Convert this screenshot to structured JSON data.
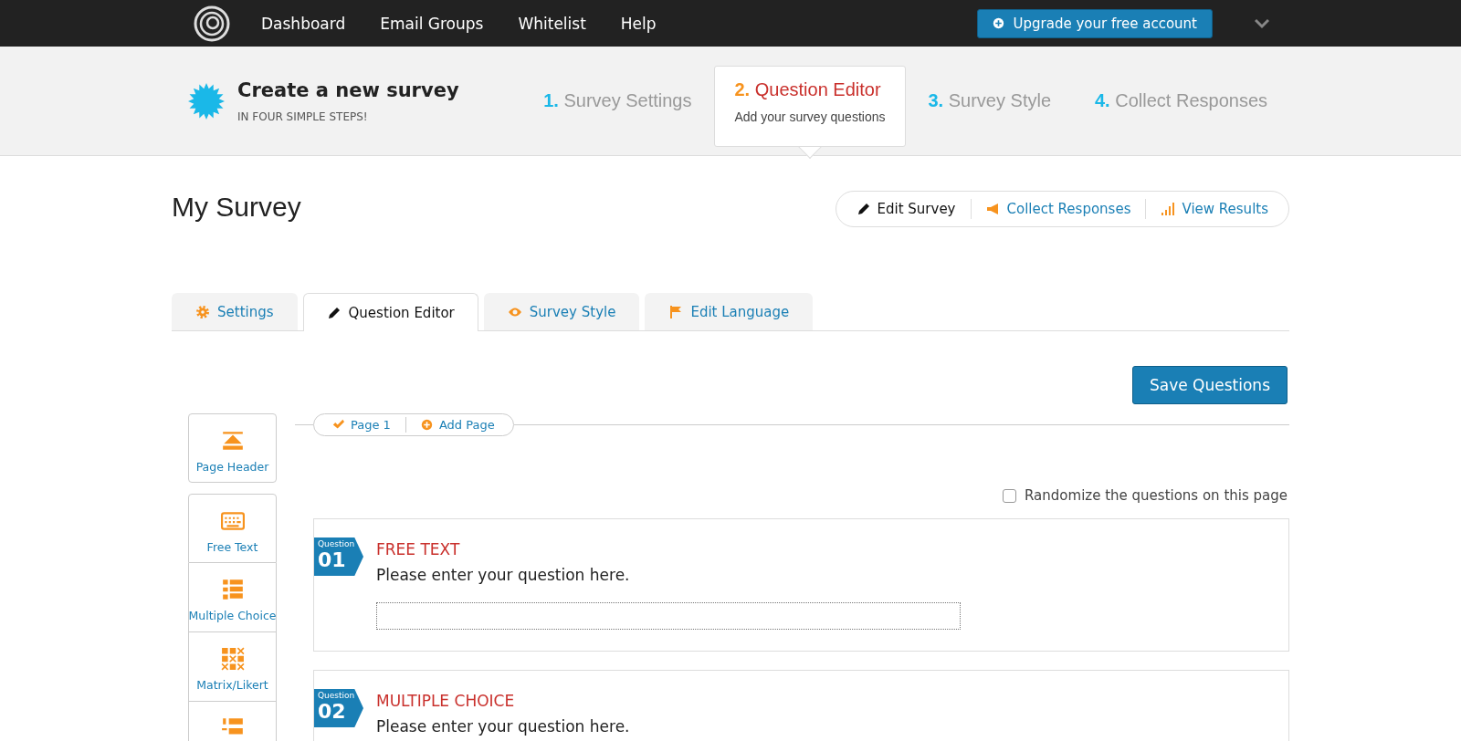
{
  "nav": {
    "links": [
      "Dashboard",
      "Email Groups",
      "Whitelist",
      "Help"
    ],
    "upgrade": "Upgrade your free account"
  },
  "wizard": {
    "title": "Create a new survey",
    "subtitle": "IN FOUR SIMPLE STEPS!",
    "steps": [
      {
        "number": "1.",
        "label": "Survey Settings",
        "selected": false
      },
      {
        "number": "2.",
        "label": "Question Editor",
        "hint": "Add your survey questions",
        "selected": true
      },
      {
        "number": "3.",
        "label": "Survey Style",
        "selected": false
      },
      {
        "number": "4.",
        "label": "Collect Responses",
        "selected": false
      }
    ]
  },
  "survey_title": "My Survey",
  "actions": [
    {
      "kind": "pencil",
      "label": "Edit Survey",
      "selected": true
    },
    {
      "kind": "megaphone",
      "label": "Collect Responses",
      "selected": false
    },
    {
      "kind": "bars",
      "label": "View Results",
      "selected": false
    }
  ],
  "tabs": [
    {
      "kind": "gear",
      "label": "Settings",
      "selected": false
    },
    {
      "kind": "pencil",
      "label": "Question Editor",
      "selected": true
    },
    {
      "kind": "eye",
      "label": "Survey Style",
      "selected": false
    },
    {
      "kind": "flag",
      "label": "Edit Language",
      "selected": false
    }
  ],
  "save_button": "Save Questions",
  "pages": [
    {
      "kind": "check",
      "label": "Page 1"
    },
    {
      "kind": "plus",
      "label": "Add Page"
    }
  ],
  "sidebar": [
    {
      "kind": "header",
      "label": "Page Header"
    },
    {
      "kind": "keyboard",
      "label": "Free Text"
    },
    {
      "kind": "list",
      "label": "Multiple Choice"
    },
    {
      "kind": "matrix",
      "label": "Matrix/Likert"
    },
    {
      "kind": "ranking"
    }
  ],
  "randomize": {
    "label": "Randomize the questions on this page",
    "checked": false
  },
  "questions": [
    {
      "kind": "free_text",
      "tag": "Question",
      "number": "01",
      "type": "FREE TEXT",
      "text": "Please enter your question here."
    },
    {
      "kind": "choice",
      "tag": "Question",
      "number": "02",
      "type": "MULTIPLE CHOICE",
      "text": "Please enter your question here."
    }
  ]
}
